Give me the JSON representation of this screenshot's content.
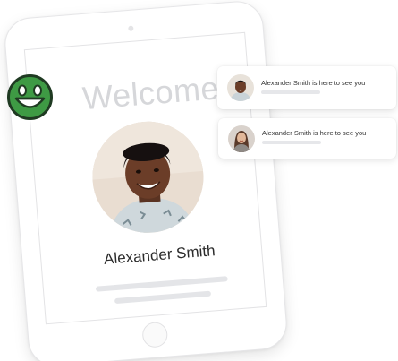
{
  "tablet": {
    "welcome_text": "Welcome",
    "visitor_name": "Alexander Smith"
  },
  "notifications": [
    {
      "message": "Alexander Smith is here to see you",
      "avatar": "man-portrait"
    },
    {
      "message": "Alexander Smith is here to see you",
      "avatar": "woman-portrait"
    }
  ],
  "icons": {
    "smiley": "smiley-face-icon"
  },
  "colors": {
    "smiley_fill": "#3e9a44",
    "smiley_outline": "#1f3a22",
    "welcome_text": "#d6d7da",
    "placeholder": "#e4e5e8"
  }
}
